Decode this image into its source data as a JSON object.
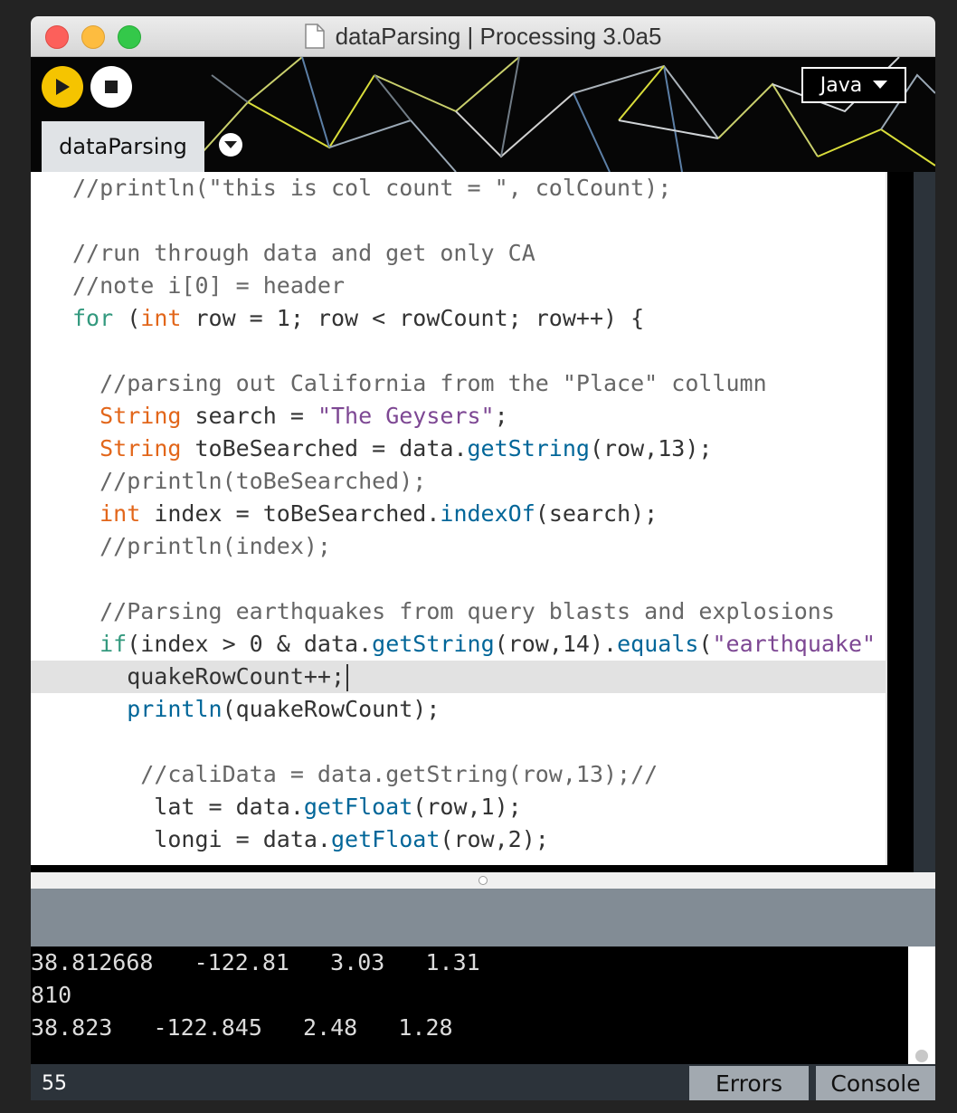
{
  "window": {
    "title": "dataParsing | Processing 3.0a5"
  },
  "toolbar": {
    "mode_label": "Java"
  },
  "tabs": [
    {
      "label": "dataParsing"
    }
  ],
  "editor": {
    "lines": [
      [
        {
          "t": "//println(\"this is col count = \", colCount);",
          "c": "cm"
        }
      ],
      [],
      [
        {
          "t": "//run through data and get only CA",
          "c": "cm"
        }
      ],
      [
        {
          "t": "//note i[0] = header",
          "c": "cm"
        }
      ],
      [
        {
          "t": "for",
          "c": "kw"
        },
        {
          "t": " ("
        },
        {
          "t": "int",
          "c": "ty"
        },
        {
          "t": " row = 1; row < rowCount; row++) {"
        }
      ],
      [],
      [
        {
          "t": "  "
        },
        {
          "t": "//parsing out California from the \"Place\" collumn",
          "c": "cm"
        }
      ],
      [
        {
          "t": "  "
        },
        {
          "t": "String",
          "c": "ty"
        },
        {
          "t": " search = "
        },
        {
          "t": "\"The Geysers\"",
          "c": "st"
        },
        {
          "t": ";"
        }
      ],
      [
        {
          "t": "  "
        },
        {
          "t": "String",
          "c": "ty"
        },
        {
          "t": " toBeSearched = data."
        },
        {
          "t": "getString",
          "c": "fn"
        },
        {
          "t": "(row,13);"
        }
      ],
      [
        {
          "t": "  "
        },
        {
          "t": "//println(toBeSearched);",
          "c": "cm"
        }
      ],
      [
        {
          "t": "  "
        },
        {
          "t": "int",
          "c": "ty"
        },
        {
          "t": " index = toBeSearched."
        },
        {
          "t": "indexOf",
          "c": "fn"
        },
        {
          "t": "(search);"
        }
      ],
      [
        {
          "t": "  "
        },
        {
          "t": "//println(index);",
          "c": "cm"
        }
      ],
      [],
      [
        {
          "t": "  "
        },
        {
          "t": "//Parsing earthquakes from query blasts and explosions",
          "c": "cm"
        }
      ],
      [
        {
          "t": "  "
        },
        {
          "t": "if",
          "c": "kw"
        },
        {
          "t": "(index > 0 & data."
        },
        {
          "t": "getString",
          "c": "fn"
        },
        {
          "t": "(row,14)."
        },
        {
          "t": "equals",
          "c": "fn"
        },
        {
          "t": "("
        },
        {
          "t": "\"earthquake\"",
          "c": "st"
        }
      ],
      [
        {
          "t": "    quakeRowCount++;"
        }
      ],
      [
        {
          "t": "    "
        },
        {
          "t": "println",
          "c": "fn"
        },
        {
          "t": "(quakeRowCount);"
        }
      ],
      [],
      [
        {
          "t": "     "
        },
        {
          "t": "//caliData = data.getString(row,13);//",
          "c": "cm"
        }
      ],
      [
        {
          "t": "      lat = data."
        },
        {
          "t": "getFloat",
          "c": "fn"
        },
        {
          "t": "(row,1);"
        }
      ],
      [
        {
          "t": "      longi = data."
        },
        {
          "t": "getFloat",
          "c": "fn"
        },
        {
          "t": "(row,2);"
        }
      ]
    ]
  },
  "console": {
    "lines": [
      "38.812668   -122.81   3.03   1.31",
      "810",
      "38.823   -122.845   2.48   1.28"
    ]
  },
  "status": {
    "line_number": "55"
  },
  "footer": {
    "errors_label": "Errors",
    "console_label": "Console"
  }
}
